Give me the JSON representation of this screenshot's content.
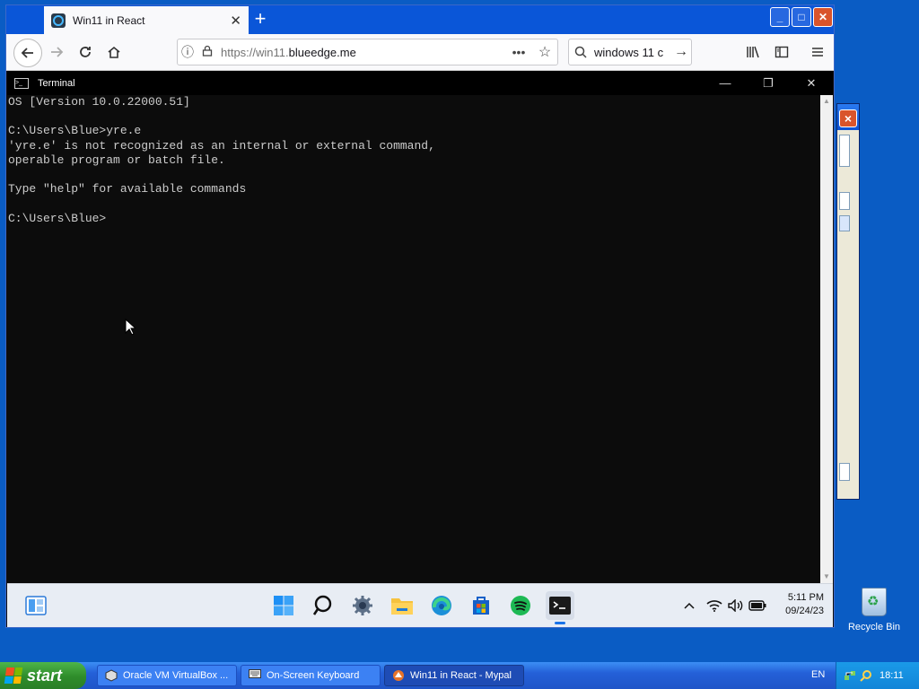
{
  "browser": {
    "tab_title": "Win11 in React",
    "tab_close": "✕",
    "new_tab": "+",
    "url_prefix": "https://win11.",
    "url_domain": "blueedge.me",
    "url_more": "•••",
    "search_text": "windows 11 c"
  },
  "terminal": {
    "title": "Terminal",
    "lines": [
      "OS [Version 10.0.22000.51]",
      "",
      "C:\\Users\\Blue>yre.e",
      "'yre.e' is not recognized as an internal or external command,",
      "operable program or batch file.",
      "",
      "Type \"help\" for available commands",
      "",
      "C:\\Users\\Blue>"
    ]
  },
  "w11_taskbar": {
    "time": "5:11 PM",
    "date": "09/24/23"
  },
  "desktop": {
    "recycle_bin_label": "Recycle Bin"
  },
  "xp_taskbar": {
    "start_label": "start",
    "tasks": [
      {
        "label": "Oracle VM VirtualBox ..."
      },
      {
        "label": "On-Screen Keyboard"
      },
      {
        "label": "Win11 in React - Mypal"
      }
    ],
    "language": "EN",
    "clock": "18:11"
  }
}
